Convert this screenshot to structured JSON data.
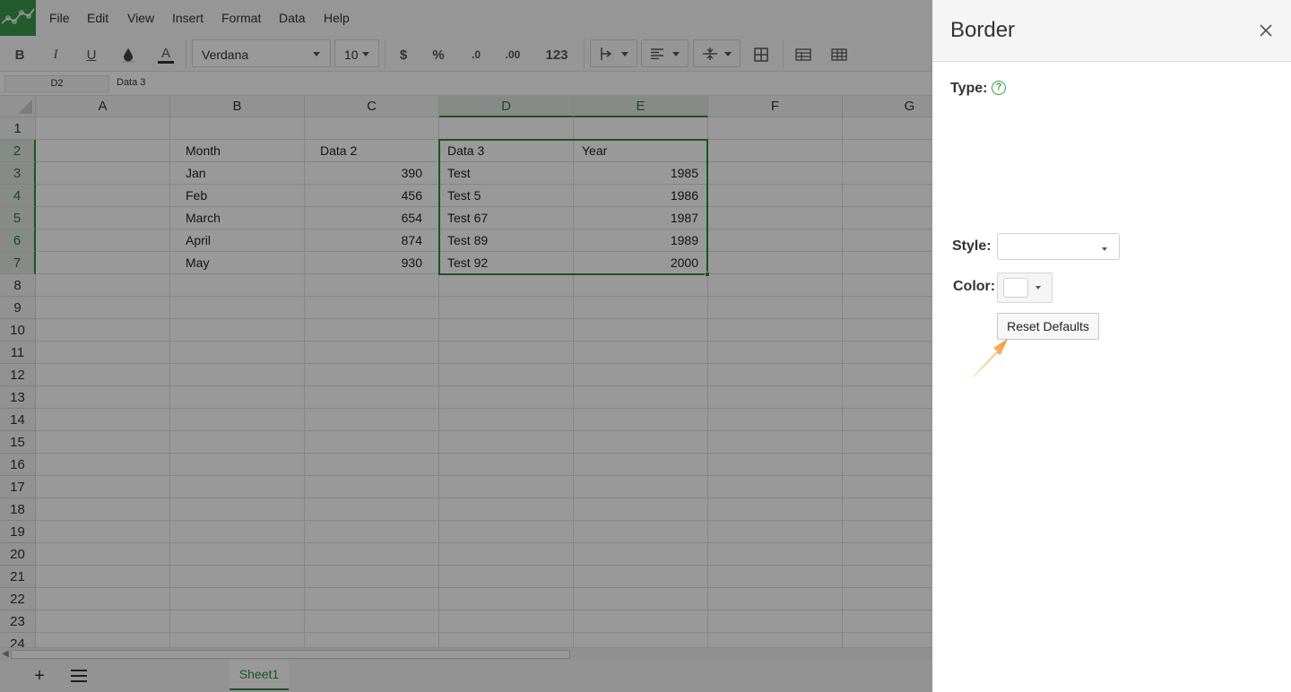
{
  "menu": {
    "items": [
      "File",
      "Edit",
      "View",
      "Insert",
      "Format",
      "Data",
      "Help"
    ]
  },
  "toolbar": {
    "bold": "B",
    "italic": "I",
    "underline": "U",
    "text_color": "A",
    "font_family": "Verdana",
    "font_size": "10",
    "currency": "$",
    "percent": "%",
    "decrease_decimal": ".0",
    "increase_decimal": ".00",
    "number_format": "123"
  },
  "formula_bar": {
    "cell_ref": "D2",
    "value": "Data 3"
  },
  "grid": {
    "columns": [
      "A",
      "B",
      "C",
      "D",
      "E",
      "F",
      "G"
    ],
    "rows": [
      "1",
      "2",
      "3",
      "4",
      "5",
      "6",
      "7",
      "8",
      "9",
      "10",
      "11",
      "12",
      "13",
      "14",
      "15",
      "16",
      "17",
      "18",
      "19",
      "20",
      "21",
      "22",
      "23",
      "24"
    ],
    "headers": {
      "B": "Month",
      "C": "Data 2",
      "D": "Data 3",
      "E": "Year"
    },
    "data": [
      {
        "month": "Jan",
        "data2": "390",
        "data3": "Test",
        "year": "1985"
      },
      {
        "month": "Feb",
        "data2": "456",
        "data3": "Test 5",
        "year": "1986"
      },
      {
        "month": "March",
        "data2": "654",
        "data3": "Test 67",
        "year": "1987"
      },
      {
        "month": "April",
        "data2": "874",
        "data3": "Test 89",
        "year": "1989"
      },
      {
        "month": "May",
        "data2": "930",
        "data3": "Test 92",
        "year": "2000"
      }
    ],
    "selected_columns": [
      "D",
      "E"
    ],
    "selected_rows": [
      "2",
      "3",
      "4",
      "5",
      "6",
      "7"
    ]
  },
  "sheets": {
    "active": "Sheet1"
  },
  "border_panel": {
    "title": "Border",
    "type_label": "Type:",
    "help_icon": "?",
    "style_label": "Style:",
    "style_value": "",
    "color_label": "Color:",
    "color_value": "#ffffff",
    "reset_label": "Reset Defaults"
  },
  "colors": {
    "accent": "#2e8b3e",
    "annotation_arrow": "#f0932b"
  },
  "icons": {
    "close": "close-icon",
    "help": "help-circle-icon",
    "fill": "fill-color-icon",
    "add_sheet": "plus-icon",
    "sheet_list": "list-icon"
  }
}
